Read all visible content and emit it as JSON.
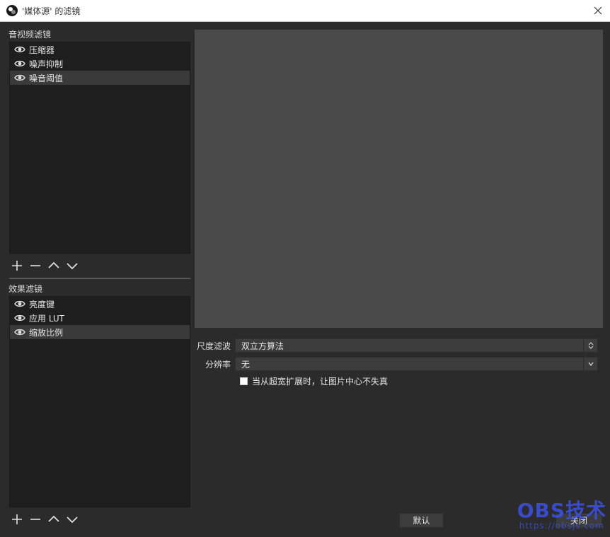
{
  "window": {
    "title": "'媒体源' 的滤镜"
  },
  "audio_filters": {
    "label": "音视频滤镜",
    "items": [
      {
        "label": "压缩器",
        "selected": false
      },
      {
        "label": "噪声抑制",
        "selected": false
      },
      {
        "label": "噪音阈值",
        "selected": true
      }
    ]
  },
  "effect_filters": {
    "label": "效果滤镜",
    "items": [
      {
        "label": "亮度键",
        "selected": false
      },
      {
        "label": "应用 LUT",
        "selected": false
      },
      {
        "label": "缩放比例",
        "selected": true
      }
    ]
  },
  "properties": {
    "scale_filter": {
      "label": "尺度滤波",
      "value": "双立方算法"
    },
    "resolution": {
      "label": "分辨率",
      "value": "无"
    },
    "undistort": {
      "label": "当从超宽扩展时，让图片中心不失真",
      "checked": false
    }
  },
  "buttons": {
    "defaults": "默认",
    "close": "关闭"
  },
  "watermark": {
    "main": "OBS技术",
    "sub": "https://obsjs.com"
  },
  "colors": {
    "background": "#2b2b2b",
    "list_bg": "#1e1e1e",
    "preview_bg": "#4a4a4a",
    "selected_row": "#3a3a3a"
  }
}
